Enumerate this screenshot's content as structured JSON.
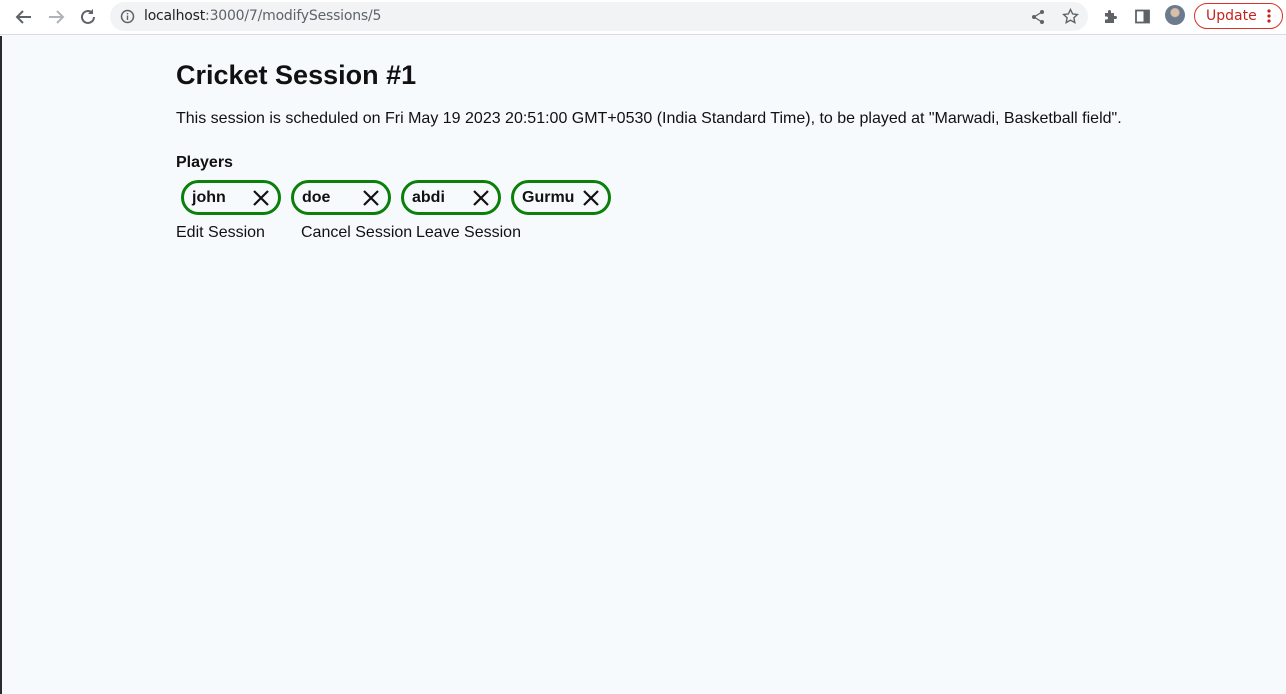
{
  "browser": {
    "url_host": "localhost",
    "url_path": ":3000/7/modifySessions/5",
    "update_label": "Update"
  },
  "session": {
    "title": "Cricket Session #1",
    "description": "This session is scheduled on Fri May 19 2023 20:51:00 GMT+0530 (India Standard Time), to be played at \"Marwadi, Basketball field\".",
    "players_label": "Players",
    "players": [
      "john",
      "doe",
      "abdi",
      "Gurmu"
    ],
    "actions": {
      "edit": "Edit Session",
      "cancel": "Cancel Session",
      "leave": "Leave Session"
    }
  },
  "colors": {
    "chip_border": "#0a7f0a",
    "page_bg": "#f7fafc",
    "update_red": "#d93025"
  }
}
